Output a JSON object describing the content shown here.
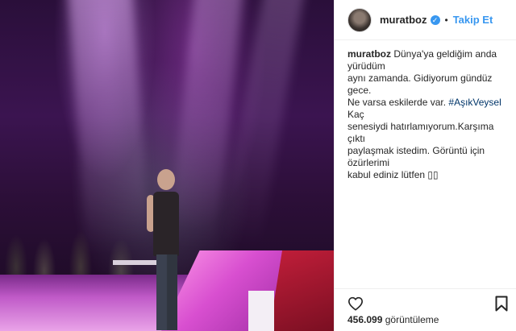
{
  "post": {
    "username": "muratboz",
    "follow_label": "Takip Et",
    "separator": "•",
    "verified_badge": "check-icon"
  },
  "caption": {
    "username": "muratboz",
    "line1": "Dünya'ya geldiğim anda yürüdüm",
    "line2": "aynı zamanda. Gidiyorum gündüz gece.",
    "line3a": "Ne varsa eskilerde var. ",
    "hashtag": "#AşıkVeysel",
    "line3b": " Kaç",
    "line4": "senesiydi hatırlamıyorum.Karşıma çıktı",
    "line5": "paylaşmak istedim. Görüntü için özürlerimi",
    "line6": "kabul ediniz lütfen ▯▯"
  },
  "stats": {
    "views_count": "456.099",
    "views_label": "görüntüleme"
  },
  "icons": {
    "like": "heart-icon",
    "save": "bookmark-icon"
  },
  "colors": {
    "accent": "#3897f0",
    "hashtag": "#003569",
    "text": "#262626"
  }
}
